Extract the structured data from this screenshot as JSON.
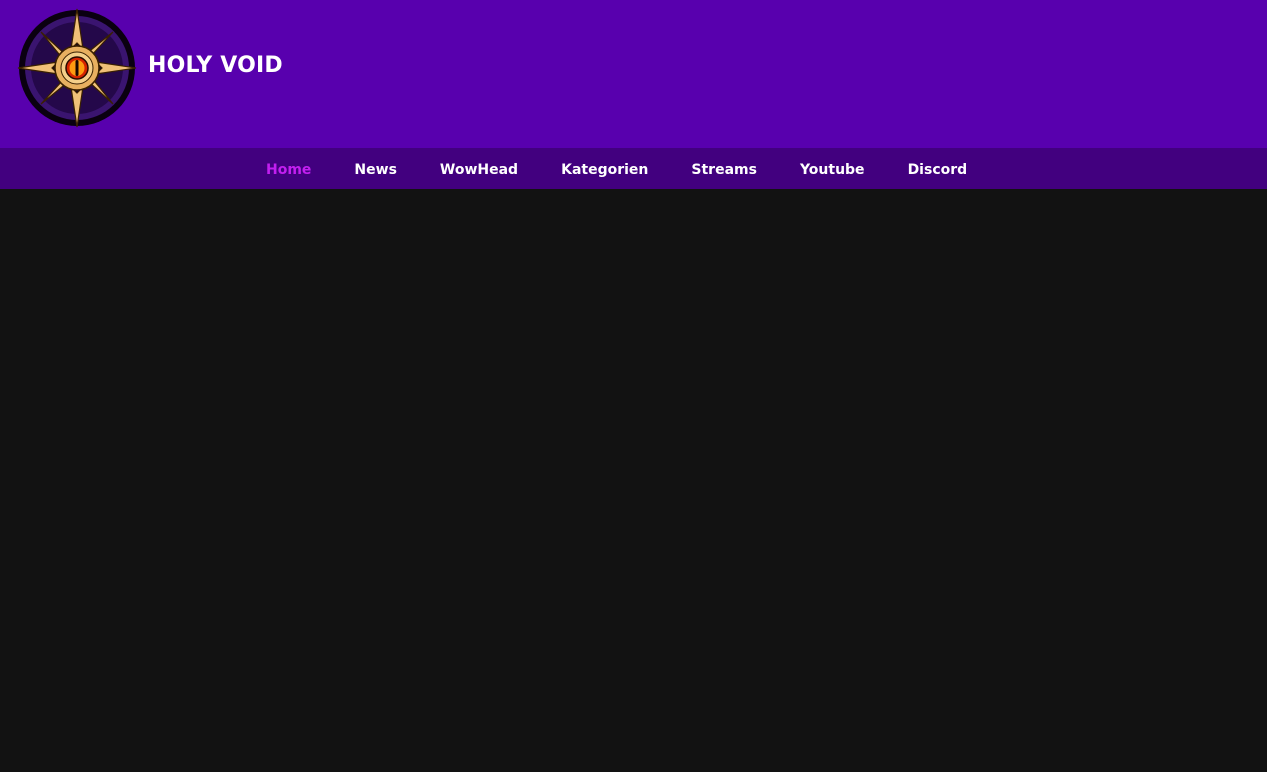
{
  "site": {
    "title": "HOLY VOID",
    "logo_icon": "void-eye-star-icon"
  },
  "nav": {
    "items": [
      {
        "label": "Home",
        "active": true
      },
      {
        "label": "News",
        "active": false
      },
      {
        "label": "WowHead",
        "active": false
      },
      {
        "label": "Kategorien",
        "active": false
      },
      {
        "label": "Streams",
        "active": false
      },
      {
        "label": "Youtube",
        "active": false
      },
      {
        "label": "Discord",
        "active": false
      }
    ]
  },
  "colors": {
    "header_bg": "#5800ae",
    "nav_bg": "#42007f",
    "active_link": "#c21ff0",
    "page_bg": "#121212"
  }
}
